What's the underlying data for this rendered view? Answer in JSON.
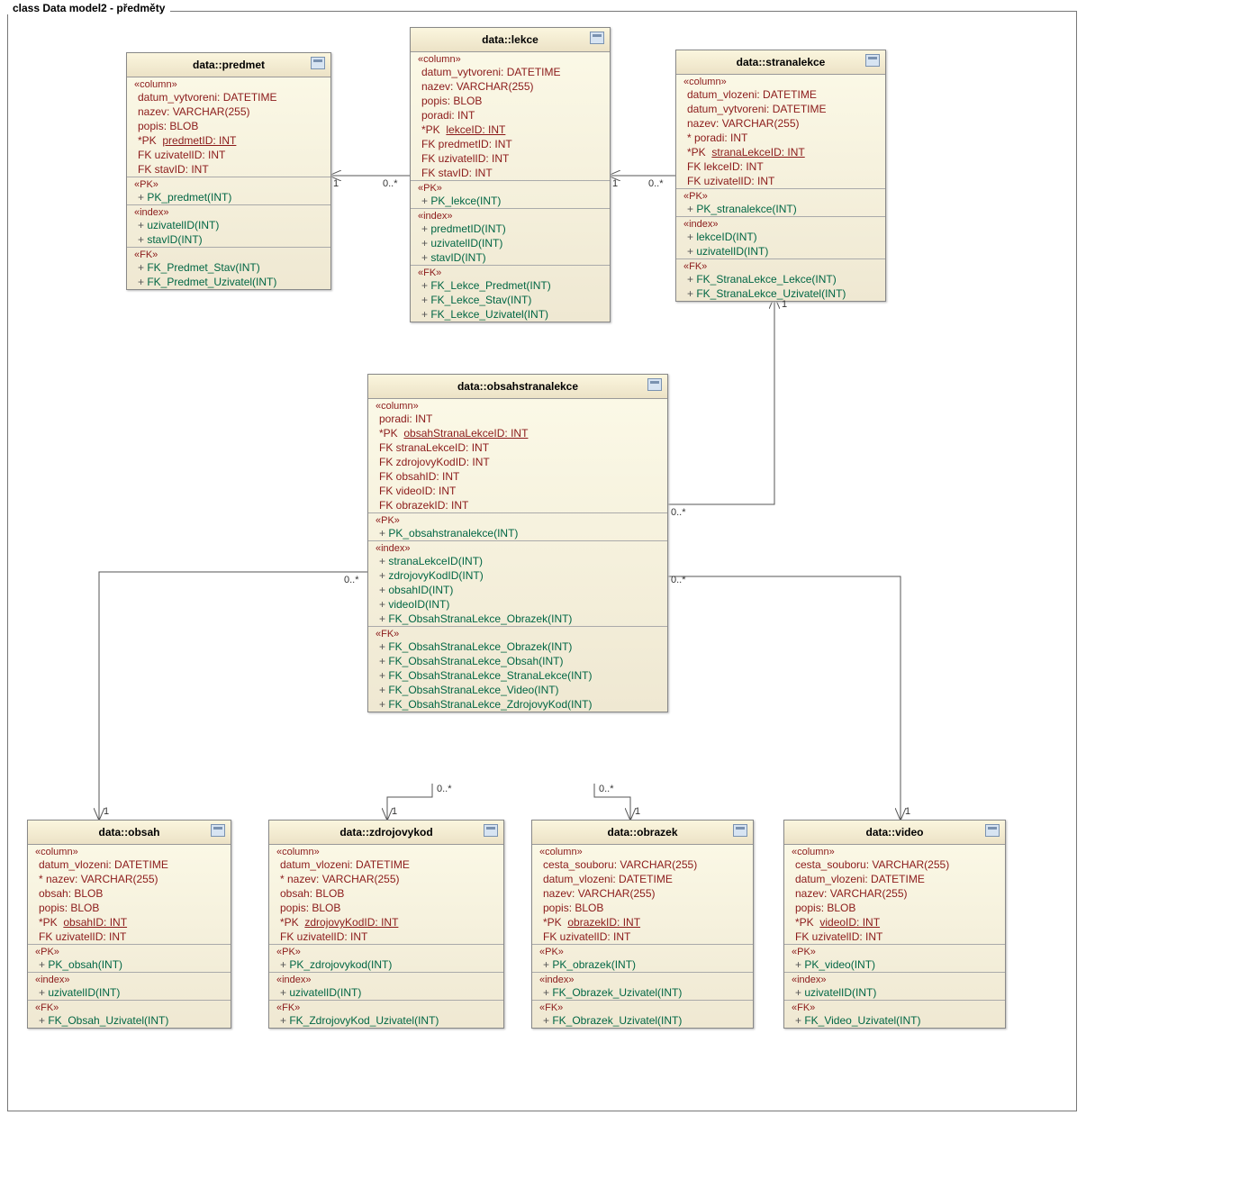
{
  "diagramTitle": "class Data model2 - předměty",
  "entities": {
    "predmet": {
      "title": "data::predmet",
      "colStereo": "«column»",
      "cols": [
        "        datum_vytvoreni:  DATETIME",
        "        nazev:  VARCHAR(255)",
        "        popis:  BLOB",
        "*PK  predmetID:  INT",
        " FK   uzivatelID:  INT",
        " FK   stavID:  INT"
      ],
      "pkStereo": "«PK»",
      "pks": [
        "PK_predmet(INT)"
      ],
      "idxStereo": "«index»",
      "idxs": [
        "uzivatelID(INT)",
        "stavID(INT)"
      ],
      "fkStereo": "«FK»",
      "fks": [
        "FK_Predmet_Stav(INT)",
        "FK_Predmet_Uzivatel(INT)"
      ]
    },
    "lekce": {
      "title": "data::lekce",
      "colStereo": "«column»",
      "cols": [
        "        datum_vytvoreni:  DATETIME",
        "        nazev:  VARCHAR(255)",
        "        popis:  BLOB",
        "        poradi:  INT",
        "*PK  lekceID:  INT",
        " FK   predmetID:  INT",
        " FK   uzivatelID:  INT",
        " FK   stavID:  INT"
      ],
      "pkStereo": "«PK»",
      "pks": [
        "PK_lekce(INT)"
      ],
      "idxStereo": "«index»",
      "idxs": [
        "predmetID(INT)",
        "uzivatelID(INT)",
        "stavID(INT)"
      ],
      "fkStereo": "«FK»",
      "fks": [
        "FK_Lekce_Predmet(INT)",
        "FK_Lekce_Stav(INT)",
        "FK_Lekce_Uzivatel(INT)"
      ]
    },
    "stranalekce": {
      "title": "data::stranalekce",
      "colStereo": "«column»",
      "cols": [
        "        datum_vlozeni:  DATETIME",
        "        datum_vytvoreni:  DATETIME",
        "        nazev:  VARCHAR(255)",
        "*      poradi:  INT",
        "*PK  stranaLekceID:  INT",
        " FK   lekceID:  INT",
        " FK   uzivatelID:  INT"
      ],
      "pkStereo": "«PK»",
      "pks": [
        "PK_stranalekce(INT)"
      ],
      "idxStereo": "«index»",
      "idxs": [
        "lekceID(INT)",
        "uzivatelID(INT)"
      ],
      "fkStereo": "«FK»",
      "fks": [
        "FK_StranaLekce_Lekce(INT)",
        "FK_StranaLekce_Uzivatel(INT)"
      ]
    },
    "obsahstranalekce": {
      "title": "data::obsahstranalekce",
      "colStereo": "«column»",
      "cols": [
        "        poradi:  INT",
        "*PK  obsahStranaLekceID:  INT",
        " FK   stranaLekceID:  INT",
        " FK   zdrojovyKodID:  INT",
        " FK   obsahID:  INT",
        " FK   videoID:  INT",
        " FK   obrazekID:  INT"
      ],
      "pkStereo": "«PK»",
      "pks": [
        "PK_obsahstranalekce(INT)"
      ],
      "idxStereo": "«index»",
      "idxs": [
        "stranaLekceID(INT)",
        "zdrojovyKodID(INT)",
        "obsahID(INT)",
        "videoID(INT)",
        "FK_ObsahStranaLekce_Obrazek(INT)"
      ],
      "fkStereo": "«FK»",
      "fks": [
        "FK_ObsahStranaLekce_Obrazek(INT)",
        "FK_ObsahStranaLekce_Obsah(INT)",
        "FK_ObsahStranaLekce_StranaLekce(INT)",
        "FK_ObsahStranaLekce_Video(INT)",
        "FK_ObsahStranaLekce_ZdrojovyKod(INT)"
      ]
    },
    "obsah": {
      "title": "data::obsah",
      "colStereo": "«column»",
      "cols": [
        "        datum_vlozeni:  DATETIME",
        "*      nazev:  VARCHAR(255)",
        "        obsah:  BLOB",
        "        popis:  BLOB",
        "*PK  obsahID:  INT",
        " FK   uzivatelID:  INT"
      ],
      "pkStereo": "«PK»",
      "pks": [
        "PK_obsah(INT)"
      ],
      "idxStereo": "«index»",
      "idxs": [
        "uzivatelID(INT)"
      ],
      "fkStereo": "«FK»",
      "fks": [
        "FK_Obsah_Uzivatel(INT)"
      ]
    },
    "zdrojovykod": {
      "title": "data::zdrojovykod",
      "colStereo": "«column»",
      "cols": [
        "        datum_vlozeni:  DATETIME",
        "*      nazev:  VARCHAR(255)",
        "        obsah:  BLOB",
        "        popis:  BLOB",
        "*PK  zdrojovyKodID:  INT",
        " FK   uzivatelID:  INT"
      ],
      "pkStereo": "«PK»",
      "pks": [
        "PK_zdrojovykod(INT)"
      ],
      "idxStereo": "«index»",
      "idxs": [
        "uzivatelID(INT)"
      ],
      "fkStereo": "«FK»",
      "fks": [
        "FK_ZdrojovyKod_Uzivatel(INT)"
      ]
    },
    "obrazek": {
      "title": "data::obrazek",
      "colStereo": "«column»",
      "cols": [
        "        cesta_souboru:  VARCHAR(255)",
        "        datum_vlozeni:  DATETIME",
        "        nazev:  VARCHAR(255)",
        "        popis:  BLOB",
        "*PK  obrazekID:  INT",
        " FK   uzivatelID:  INT"
      ],
      "pkStereo": "«PK»",
      "pks": [
        "PK_obrazek(INT)"
      ],
      "idxStereo": "«index»",
      "idxs": [
        "FK_Obrazek_Uzivatel(INT)"
      ],
      "fkStereo": "«FK»",
      "fks": [
        "FK_Obrazek_Uzivatel(INT)"
      ]
    },
    "video": {
      "title": "data::video",
      "colStereo": "«column»",
      "cols": [
        "        cesta_souboru:  VARCHAR(255)",
        "        datum_vlozeni:  DATETIME",
        "        nazev:  VARCHAR(255)",
        "        popis:  BLOB",
        "*PK  videoID:  INT",
        " FK   uzivatelID:  INT"
      ],
      "pkStereo": "«PK»",
      "pks": [
        "PK_video(INT)"
      ],
      "idxStereo": "«index»",
      "idxs": [
        "uzivatelID(INT)"
      ],
      "fkStereo": "«FK»",
      "fks": [
        "FK_Video_Uzivatel(INT)"
      ]
    }
  },
  "multiplicities": {
    "predmet_right": "1",
    "lekce_left": "0..*",
    "lekce_right": "1",
    "stranalekce_left": "0..*",
    "stranalekce_bottom": "1",
    "osl_top_right": "0..*",
    "osl_left": "0..*",
    "osl_right": "0..*",
    "osl_bottom_l": "0..*",
    "osl_bottom_r": "0..*",
    "obsah_top": "1",
    "zdrojovykod_top": "1",
    "obrazek_top": "1",
    "video_top": "1"
  }
}
